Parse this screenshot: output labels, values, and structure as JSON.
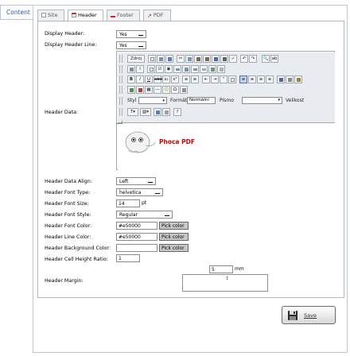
{
  "content_tab": "Content",
  "tabs": [
    {
      "label": "Site",
      "icon": "page-icon",
      "active": false
    },
    {
      "label": "Header",
      "icon": "header-icon",
      "active": true
    },
    {
      "label": "Footer",
      "icon": "footer-icon",
      "active": false
    },
    {
      "label": "PDF",
      "icon": "pdf-icon",
      "active": false
    }
  ],
  "fields": {
    "display_header": {
      "label": "Display Header:",
      "value": "Yes"
    },
    "display_header_line": {
      "label": "Display Header Line:",
      "value": "Yes"
    },
    "header_data": {
      "label": "Header Data:"
    },
    "header_data_align": {
      "label": "Header Data Align:",
      "value": "Left"
    },
    "header_font_type": {
      "label": "Header Font Type:",
      "value": "helvetica"
    },
    "header_font_size": {
      "label": "Header Font Size:",
      "value": "14",
      "unit": "pt"
    },
    "header_font_style": {
      "label": "Header Font Style:",
      "value": "Regular"
    },
    "header_font_color": {
      "label": "Header Font Color:",
      "value": "#e50000",
      "button": "Pick color"
    },
    "header_line_color": {
      "label": "Header Line Color:",
      "value": "#e50000",
      "button": "Pick color"
    },
    "header_background_color": {
      "label": "Header Background Color:",
      "value": "",
      "button": "Pick color"
    },
    "header_cell_height_ratio": {
      "label": "Header Cell Height Ratio:",
      "value": "1"
    },
    "header_margin": {
      "label": "Header Margin:",
      "value": "5",
      "unit": "mm"
    }
  },
  "editor": {
    "source_label": "Zdroj",
    "style_label": "Styl",
    "format_label": "Formát",
    "format_value": "Normální",
    "font_label": "Písmo",
    "size_label": "Velikost",
    "content_text": "Phoca PDF",
    "content_color": "#cc0000"
  },
  "save_label": "Save"
}
